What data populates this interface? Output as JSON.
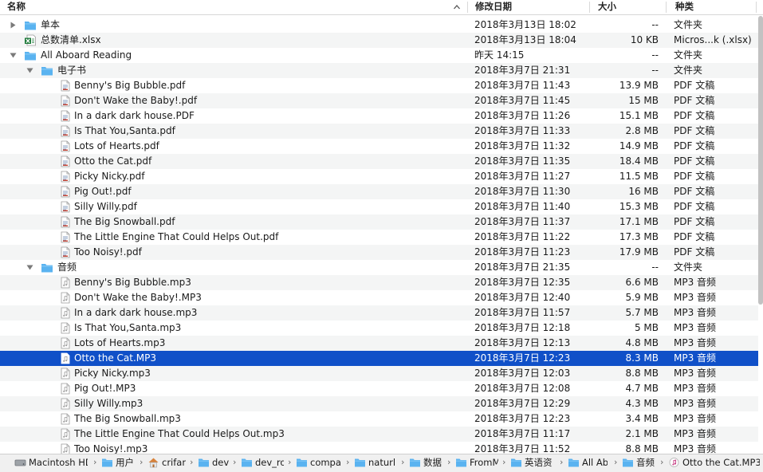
{
  "columns": {
    "name": "名称",
    "date": "修改日期",
    "size": "大小",
    "kind": "种类"
  },
  "rows": [
    {
      "name": "单本",
      "date": "2018年3月13日 18:02",
      "size": "--",
      "kind": "文件夹",
      "type": "folder",
      "level": 0,
      "expanded": false
    },
    {
      "name": "总数清单.xlsx",
      "date": "2018年3月13日 18:04",
      "size": "10 KB",
      "kind": "Micros...k (.xlsx)",
      "type": "xlsx",
      "level": 0
    },
    {
      "name": "All Aboard Reading",
      "date": "昨天 14:15",
      "size": "--",
      "kind": "文件夹",
      "type": "folder",
      "level": 0,
      "expanded": true
    },
    {
      "name": "电子书",
      "date": "2018年3月7日 21:31",
      "size": "--",
      "kind": "文件夹",
      "type": "folder",
      "level": 1,
      "expanded": true
    },
    {
      "name": "Benny's Big Bubble.pdf",
      "date": "2018年3月7日 11:43",
      "size": "13.9 MB",
      "kind": "PDF 文稿",
      "type": "pdf",
      "level": 2
    },
    {
      "name": "Don't Wake the Baby!.pdf",
      "date": "2018年3月7日 11:45",
      "size": "15 MB",
      "kind": "PDF 文稿",
      "type": "pdf",
      "level": 2
    },
    {
      "name": "In a dark dark house.PDF",
      "date": "2018年3月7日 11:26",
      "size": "15.1 MB",
      "kind": "PDF 文稿",
      "type": "pdf",
      "level": 2
    },
    {
      "name": "Is That You,Santa.pdf",
      "date": "2018年3月7日 11:33",
      "size": "2.8 MB",
      "kind": "PDF 文稿",
      "type": "pdf",
      "level": 2
    },
    {
      "name": "Lots of Hearts.pdf",
      "date": "2018年3月7日 11:32",
      "size": "14.9 MB",
      "kind": "PDF 文稿",
      "type": "pdf",
      "level": 2
    },
    {
      "name": "Otto the Cat.pdf",
      "date": "2018年3月7日 11:35",
      "size": "18.4 MB",
      "kind": "PDF 文稿",
      "type": "pdf",
      "level": 2
    },
    {
      "name": "Picky Nicky.pdf",
      "date": "2018年3月7日 11:27",
      "size": "11.5 MB",
      "kind": "PDF 文稿",
      "type": "pdf",
      "level": 2
    },
    {
      "name": "Pig Out!.pdf",
      "date": "2018年3月7日 11:30",
      "size": "16 MB",
      "kind": "PDF 文稿",
      "type": "pdf",
      "level": 2
    },
    {
      "name": "Silly Willy.pdf",
      "date": "2018年3月7日 11:40",
      "size": "15.3 MB",
      "kind": "PDF 文稿",
      "type": "pdf",
      "level": 2
    },
    {
      "name": "The Big Snowball.pdf",
      "date": "2018年3月7日 11:37",
      "size": "17.1 MB",
      "kind": "PDF 文稿",
      "type": "pdf",
      "level": 2
    },
    {
      "name": "The Little Engine That Could Helps Out.pdf",
      "date": "2018年3月7日 11:22",
      "size": "17.3 MB",
      "kind": "PDF 文稿",
      "type": "pdf",
      "level": 2
    },
    {
      "name": "Too Noisy!.pdf",
      "date": "2018年3月7日 11:23",
      "size": "17.9 MB",
      "kind": "PDF 文稿",
      "type": "pdf",
      "level": 2
    },
    {
      "name": "音频",
      "date": "2018年3月7日 21:35",
      "size": "--",
      "kind": "文件夹",
      "type": "folder",
      "level": 1,
      "expanded": true
    },
    {
      "name": "Benny's Big Bubble.mp3",
      "date": "2018年3月7日 12:35",
      "size": "6.6 MB",
      "kind": "MP3 音频",
      "type": "mp3",
      "level": 2
    },
    {
      "name": "Don't Wake the Baby!.MP3",
      "date": "2018年3月7日 12:40",
      "size": "5.9 MB",
      "kind": "MP3 音频",
      "type": "mp3",
      "level": 2
    },
    {
      "name": "In a dark dark house.mp3",
      "date": "2018年3月7日 11:57",
      "size": "5.7 MB",
      "kind": "MP3 音频",
      "type": "mp3",
      "level": 2
    },
    {
      "name": "Is That You,Santa.mp3",
      "date": "2018年3月7日 12:18",
      "size": "5 MB",
      "kind": "MP3 音频",
      "type": "mp3",
      "level": 2
    },
    {
      "name": "Lots of Hearts.mp3",
      "date": "2018年3月7日 12:13",
      "size": "4.8 MB",
      "kind": "MP3 音频",
      "type": "mp3",
      "level": 2
    },
    {
      "name": "Otto the Cat.MP3",
      "date": "2018年3月7日 12:23",
      "size": "8.3 MB",
      "kind": "MP3 音频",
      "type": "mp3",
      "level": 2,
      "selected": true
    },
    {
      "name": "Picky Nicky.mp3",
      "date": "2018年3月7日 12:03",
      "size": "8.8 MB",
      "kind": "MP3 音频",
      "type": "mp3",
      "level": 2
    },
    {
      "name": "Pig Out!.MP3",
      "date": "2018年3月7日 12:08",
      "size": "4.7 MB",
      "kind": "MP3 音频",
      "type": "mp3",
      "level": 2
    },
    {
      "name": "Silly Willy.mp3",
      "date": "2018年3月7日 12:29",
      "size": "4.3 MB",
      "kind": "MP3 音频",
      "type": "mp3",
      "level": 2
    },
    {
      "name": "The Big Snowball.mp3",
      "date": "2018年3月7日 12:23",
      "size": "3.4 MB",
      "kind": "MP3 音频",
      "type": "mp3",
      "level": 2
    },
    {
      "name": "The Little Engine That Could Helps Out.mp3",
      "date": "2018年3月7日 11:17",
      "size": "2.1 MB",
      "kind": "MP3 音频",
      "type": "mp3",
      "level": 2
    },
    {
      "name": "Too Noisy!.mp3",
      "date": "2018年3月7日 11:52",
      "size": "8.8 MB",
      "kind": "MP3 音频",
      "type": "mp3",
      "level": 2
    }
  ],
  "pathbar": [
    {
      "label": "Macintosh HD",
      "icon": "hard-drive-icon"
    },
    {
      "label": "用户",
      "icon": "folder-icon"
    },
    {
      "label": "crifan",
      "icon": "home-icon"
    },
    {
      "label": "dev",
      "icon": "folder-icon"
    },
    {
      "label": "dev_ro",
      "icon": "folder-icon"
    },
    {
      "label": "compa",
      "icon": "folder-icon"
    },
    {
      "label": "naturli",
      "icon": "folder-icon"
    },
    {
      "label": "数据",
      "icon": "folder-icon"
    },
    {
      "label": "FromM",
      "icon": "folder-icon"
    },
    {
      "label": "英语资",
      "icon": "folder-icon"
    },
    {
      "label": "All Abo",
      "icon": "folder-icon"
    },
    {
      "label": "音频",
      "icon": "folder-icon"
    },
    {
      "label": "Otto the Cat.MP3",
      "icon": "audio-file-icon"
    }
  ],
  "colors": {
    "selection": "#1050c8",
    "folder": "#5ab3f0",
    "stripe": "#f4f5f5",
    "excel": "#1e7a3a"
  }
}
